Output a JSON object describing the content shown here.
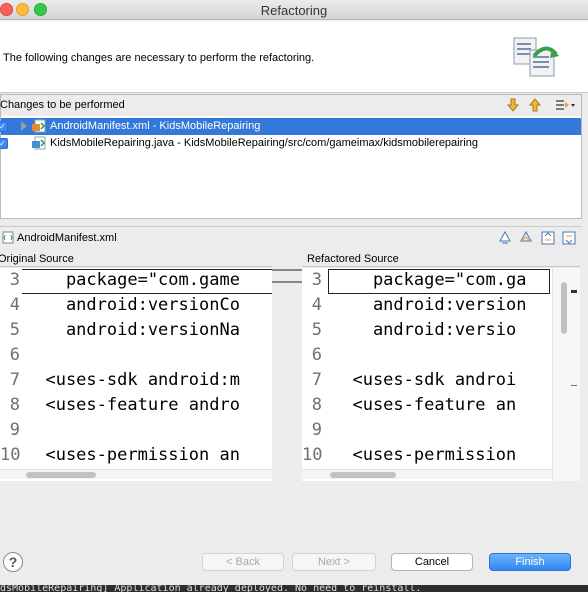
{
  "window": {
    "title": "Refactoring"
  },
  "header": {
    "message": "The following changes are necessary to perform the refactoring."
  },
  "changes": {
    "label": "Changes to be performed",
    "items": [
      {
        "label": "AndroidManifest.xml - KidsMobileRepairing",
        "checked": true,
        "selected": true,
        "expandable": true
      },
      {
        "label": "KidsMobileRepairing.java - KidsMobileRepairing/src/com/gameimax/kidsmobilerepairing",
        "checked": true,
        "selected": false,
        "expandable": false
      }
    ]
  },
  "compare": {
    "file": "AndroidManifest.xml",
    "left_title": "Original Source",
    "right_title": "Refactored Source",
    "left_lines": [
      {
        "n": "3",
        "text": "    package=\"com.game"
      },
      {
        "n": "4",
        "text": "    android:versionCo"
      },
      {
        "n": "5",
        "text": "    android:versionNa"
      },
      {
        "n": "6",
        "text": ""
      },
      {
        "n": "7",
        "text": "  <uses-sdk android:m"
      },
      {
        "n": "8",
        "text": "  <uses-feature andro"
      },
      {
        "n": "9",
        "text": ""
      },
      {
        "n": "10",
        "text": "  <uses-permission an"
      }
    ],
    "right_lines": [
      {
        "n": "3",
        "text": "    package=\"com.ga"
      },
      {
        "n": "4",
        "text": "    android:version"
      },
      {
        "n": "5",
        "text": "    android:versio"
      },
      {
        "n": "6",
        "text": ""
      },
      {
        "n": "7",
        "text": "  <uses-sdk androi"
      },
      {
        "n": "8",
        "text": "  <uses-feature an"
      },
      {
        "n": "9",
        "text": ""
      },
      {
        "n": "10",
        "text": "  <uses-permission"
      }
    ]
  },
  "buttons": {
    "help": "?",
    "back": "< Back",
    "next": "Next >",
    "cancel": "Cancel",
    "finish": "Finish"
  },
  "console_text": "dsMobileRepairing] Application already deployed. No need to reinstall.",
  "colors": {
    "selection": "#3478d9",
    "primary_button": "#2f85f4"
  }
}
